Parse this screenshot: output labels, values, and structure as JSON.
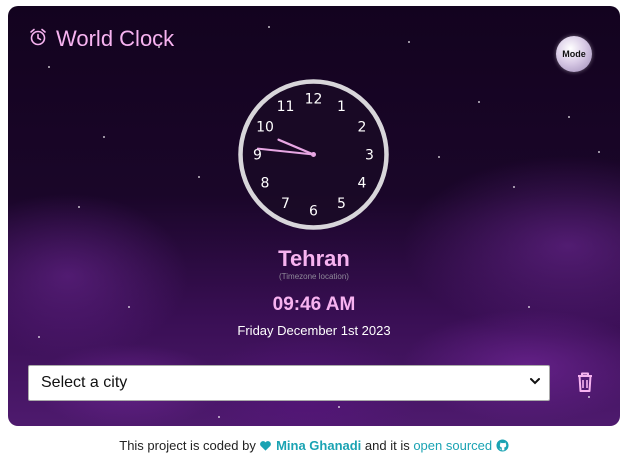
{
  "app": {
    "title": "World Clock",
    "mode_label": "Mode"
  },
  "clock": {
    "numbers": [
      "12",
      "1",
      "2",
      "3",
      "4",
      "5",
      "6",
      "7",
      "8",
      "9",
      "10",
      "11"
    ],
    "hour": 9,
    "minute": 46
  },
  "location": {
    "city": "Tehran",
    "timezone_label": "(Timezone location)",
    "time": "09:46 AM",
    "date": "Friday December 1st 2023"
  },
  "city_select": {
    "selected": "Select a city"
  },
  "footer": {
    "prefix": "This project is coded by ",
    "author": "Mina Ghanadi",
    "middle": " and it is ",
    "link": "open sourced"
  },
  "colors": {
    "accent_pink": "#f7b3f0",
    "link_teal": "#1aa3b3"
  },
  "icons": [
    "alarm-clock-icon",
    "chevron-down-icon",
    "trash-icon",
    "heart-icon",
    "github-icon"
  ]
}
